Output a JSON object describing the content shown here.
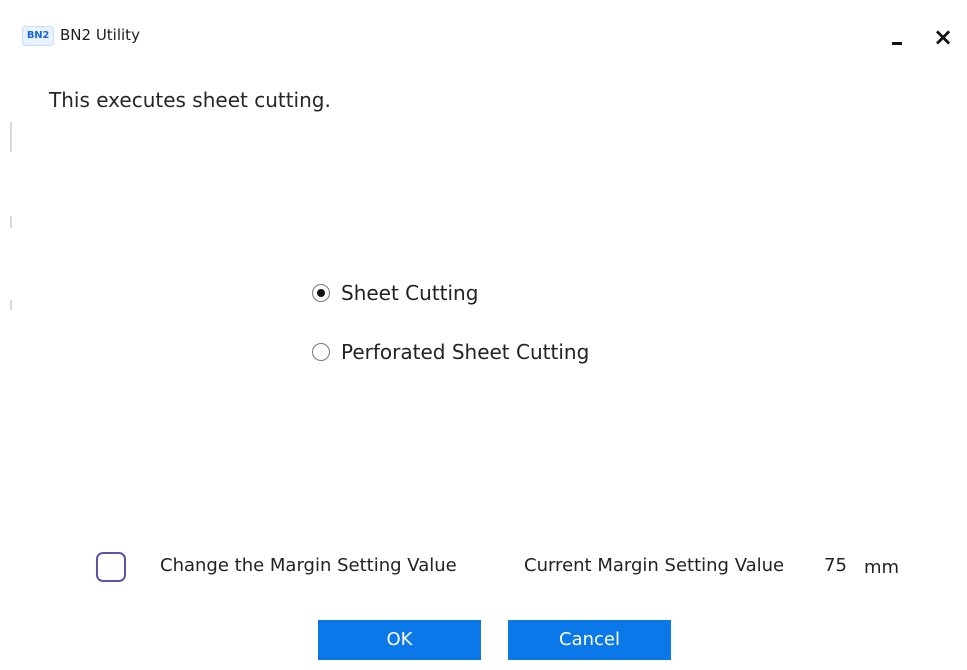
{
  "window": {
    "app_logo_text": "BN2",
    "title": "BN2 Utility",
    "minimize_icon": "minimize-icon",
    "close_icon": "close-icon"
  },
  "dialog": {
    "description": "This executes sheet cutting.",
    "options": [
      {
        "label": "Sheet Cutting",
        "selected": true
      },
      {
        "label": "Perforated Sheet Cutting",
        "selected": false
      }
    ],
    "margin": {
      "checkbox_label": "Change the Margin Setting Value",
      "checked": false,
      "current_label": "Current Margin Setting Value",
      "current_value": "75",
      "unit": "mm"
    },
    "buttons": {
      "ok": "OK",
      "cancel": "Cancel"
    }
  },
  "colors": {
    "accent": "#0a78e8",
    "checkbox_border": "#5a55a7",
    "logo_text": "#1a67d8"
  }
}
